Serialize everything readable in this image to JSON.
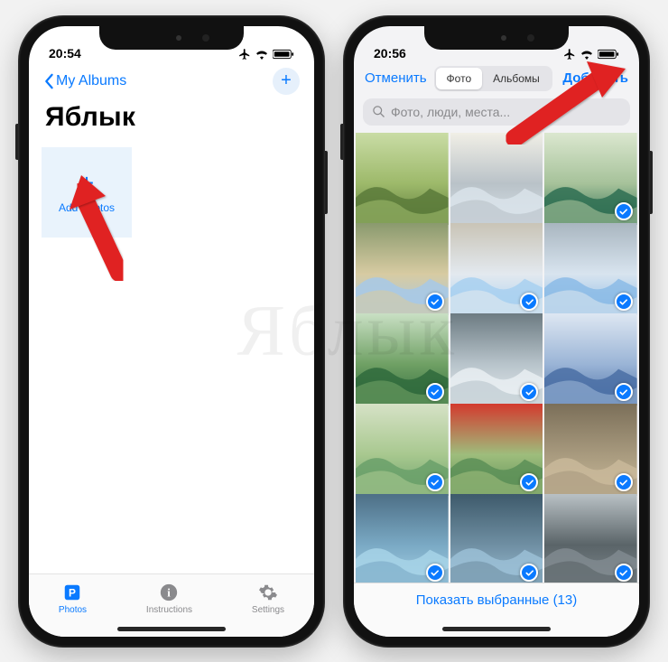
{
  "left": {
    "status": {
      "time": "20:54"
    },
    "back_label": "My Albums",
    "album_title": "Яблык",
    "add_photos_label": "Add Photos",
    "tabs": {
      "photos": "Photos",
      "instructions": "Instructions",
      "settings": "Settings"
    }
  },
  "right": {
    "status": {
      "time": "20:56"
    },
    "cancel": "Отменить",
    "seg_photos": "Фото",
    "seg_albums": "Альбомы",
    "add": "Добавить",
    "search_placeholder": "Фото, люди, места...",
    "show_selected": "Показать выбранные (13)",
    "selected_count": 13,
    "thumbs": [
      {
        "selected": false,
        "palette": [
          "#5a7a3a",
          "#9db96a",
          "#c9dca5"
        ]
      },
      {
        "selected": false,
        "palette": [
          "#d9e3ea",
          "#b9c2c8",
          "#f1efe6"
        ]
      },
      {
        "selected": true,
        "palette": [
          "#2e6e52",
          "#a6c29a",
          "#dbe7cf"
        ]
      },
      {
        "selected": true,
        "palette": [
          "#a7c9e8",
          "#d7cba2",
          "#8a9a6e"
        ]
      },
      {
        "selected": true,
        "palette": [
          "#a8d0f0",
          "#e3e9ef",
          "#c9c4b6"
        ]
      },
      {
        "selected": true,
        "palette": [
          "#8bbbe6",
          "#d8e4ef",
          "#a9b6c0"
        ]
      },
      {
        "selected": true,
        "palette": [
          "#2f6a3c",
          "#6fa064",
          "#c9e0c4"
        ]
      },
      {
        "selected": true,
        "palette": [
          "#e9eef2",
          "#b8c4cb",
          "#6c7b82"
        ]
      },
      {
        "selected": true,
        "palette": [
          "#4a6fa5",
          "#9ab4d6",
          "#dee7f2"
        ]
      },
      {
        "selected": true,
        "palette": [
          "#6aa06a",
          "#a8c88f",
          "#d6e2c6"
        ]
      },
      {
        "selected": true,
        "palette": [
          "#5c8f57",
          "#9ebd7c",
          "#d33a2e"
        ]
      },
      {
        "selected": true,
        "palette": [
          "#c9b99a",
          "#a89a7e",
          "#7b6f59"
        ]
      },
      {
        "selected": true,
        "palette": [
          "#a7d3e8",
          "#7aa9c4",
          "#4d6f86"
        ]
      },
      {
        "selected": true,
        "palette": [
          "#9bbfd6",
          "#6f8fa3",
          "#3e5a6b"
        ]
      },
      {
        "selected": true,
        "palette": [
          "#808a8f",
          "#5a6468",
          "#b9c1c5"
        ]
      }
    ]
  },
  "watermark": "Яблык"
}
